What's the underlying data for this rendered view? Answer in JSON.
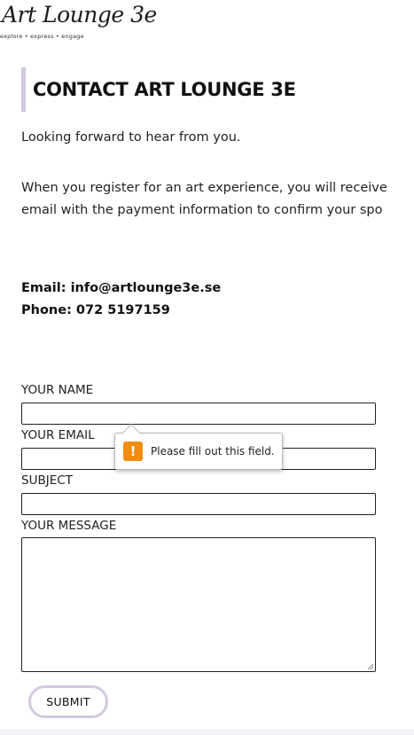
{
  "logo": {
    "name": "Art Lounge 3e",
    "tagline": "explore • express • engage"
  },
  "heading": "CONTACT ART LOUNGE 3E",
  "intro": "Looking forward to hear from you.",
  "register_text": {
    "line1": "When you register for an art experience, you will receive",
    "line2": "email with the payment information to confirm your spo"
  },
  "contact": {
    "email": "Email: info@artlounge3e.se",
    "phone": "Phone: 072 5197159"
  },
  "form": {
    "name_label": "YOUR NAME",
    "email_label": "YOUR EMAIL",
    "subject_label": "SUBJECT",
    "message_label": "YOUR MESSAGE",
    "name_value": "",
    "email_value": "",
    "subject_value": "",
    "message_value": "",
    "submit_label": "SUBMIT"
  },
  "validation": {
    "message": "Please fill out this field.",
    "icon": "warning-icon",
    "icon_glyph": "!",
    "icon_color": "#f28c0f"
  },
  "colors": {
    "accent": "#d3c9e0"
  }
}
